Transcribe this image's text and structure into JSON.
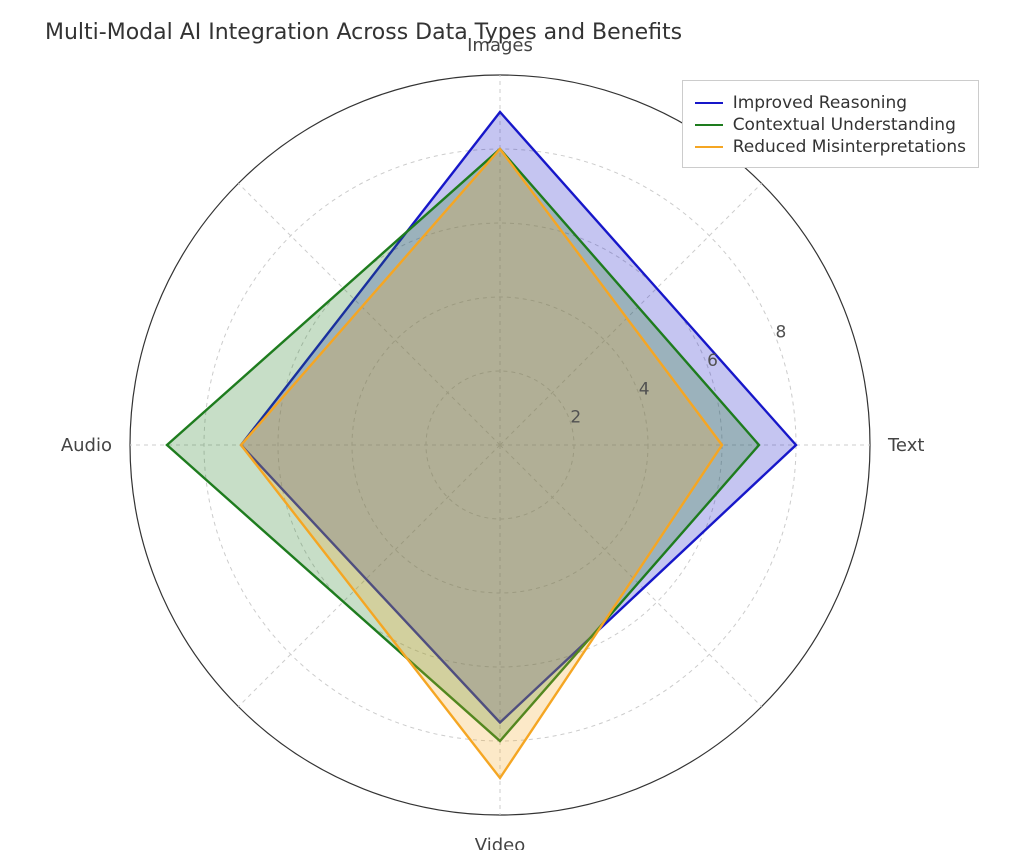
{
  "chart_data": {
    "type": "radar",
    "title": "Multi-Modal AI Integration Across Data Types and Benefits",
    "categories": [
      "Text",
      "Images",
      "Audio",
      "Video"
    ],
    "category_angles_deg": [
      0,
      90,
      180,
      270
    ],
    "r_ticks": [
      2,
      4,
      6,
      8
    ],
    "r_max": 10,
    "spoke_count": 8,
    "series": [
      {
        "name": "Improved Reasoning",
        "color": "#1717c9",
        "values": [
          8.0,
          9.0,
          7.0,
          7.5
        ]
      },
      {
        "name": "Contextual Understanding",
        "color": "#1e7c1e",
        "values": [
          7.0,
          8.0,
          9.0,
          8.0
        ]
      },
      {
        "name": "Reduced Misinterpretations",
        "color": "#f5a623",
        "values": [
          6.0,
          8.0,
          7.0,
          9.0
        ]
      }
    ],
    "legend_position": "upper right",
    "grid": true
  }
}
